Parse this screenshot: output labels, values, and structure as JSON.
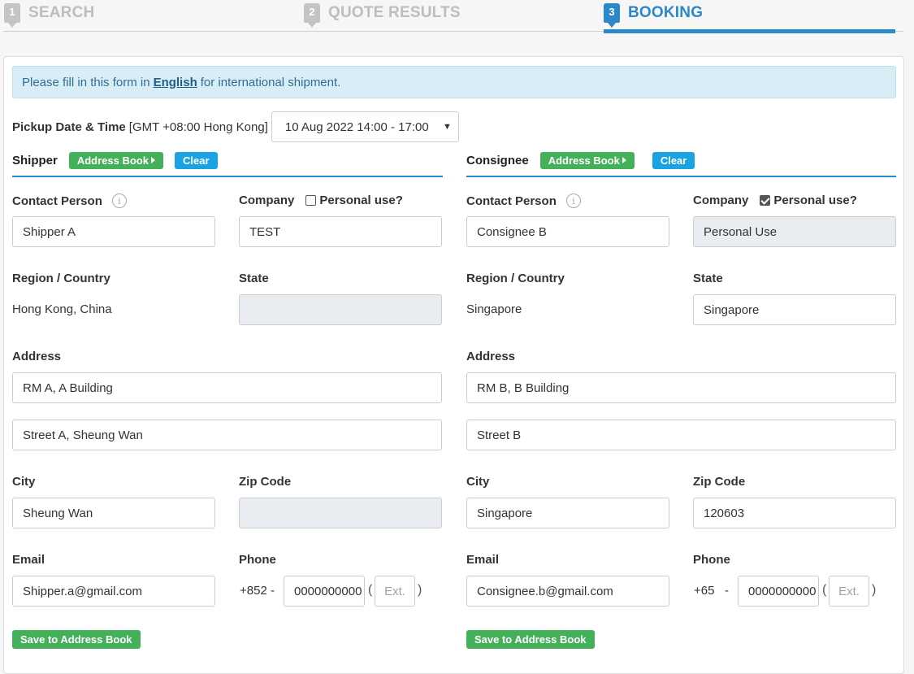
{
  "steps": [
    {
      "num": "1",
      "label": "SEARCH"
    },
    {
      "num": "2",
      "label": "QUOTE RESULTS"
    },
    {
      "num": "3",
      "label": "BOOKING"
    }
  ],
  "notice": {
    "before": "Please fill in this form in",
    "link": "English",
    "after": "for international shipment."
  },
  "pickup": {
    "label": "Pickup Date & Time",
    "timezone": "[GMT +08:00 Hong Kong]",
    "value": "10 Aug 2022 14:00 - 17:00"
  },
  "shipper": {
    "title": "Shipper",
    "address_book": "Address Book",
    "clear": "Clear",
    "contact_label": "Contact Person",
    "company_label": "Company",
    "personal_use_label": "Personal use?",
    "personal_use": false,
    "contact": "Shipper A",
    "company": "TEST",
    "region_label": "Region / Country",
    "state_label": "State",
    "region": "Hong Kong, China",
    "state": "",
    "address_label": "Address",
    "address1": "RM A, A Building",
    "address2": "Street A, Sheung Wan",
    "city_label": "City",
    "zip_label": "Zip Code",
    "city": "Sheung Wan",
    "zip": "",
    "email_label": "Email",
    "phone_label": "Phone",
    "email": "Shipper.a@gmail.com",
    "phone_prefix": "+852 -",
    "phone": "0000000000",
    "ext_placeholder": "Ext.",
    "save": "Save to Address Book"
  },
  "consignee": {
    "title": "Consignee",
    "address_book": "Address Book",
    "clear": "Clear",
    "contact_label": "Contact Person",
    "company_label": "Company",
    "personal_use_label": "Personal use?",
    "personal_use": true,
    "contact": "Consignee B",
    "company": "Personal Use",
    "region_label": "Region / Country",
    "state_label": "State",
    "region": "Singapore",
    "state": "Singapore",
    "address_label": "Address",
    "address1": "RM B, B Building",
    "address2": "Street B",
    "city_label": "City",
    "zip_label": "Zip Code",
    "city": "Singapore",
    "zip": "120603",
    "email_label": "Email",
    "phone_label": "Phone",
    "email": "Consignee.b@gmail.com",
    "phone_prefix": "+65   -",
    "phone": "0000000000",
    "ext_placeholder": "Ext.",
    "save": "Save to Address Book"
  },
  "colors": {
    "accent": "#2c88c9",
    "green": "#45b05a",
    "blue_button": "#1aa2e3",
    "notice_bg": "#d8edf6"
  }
}
